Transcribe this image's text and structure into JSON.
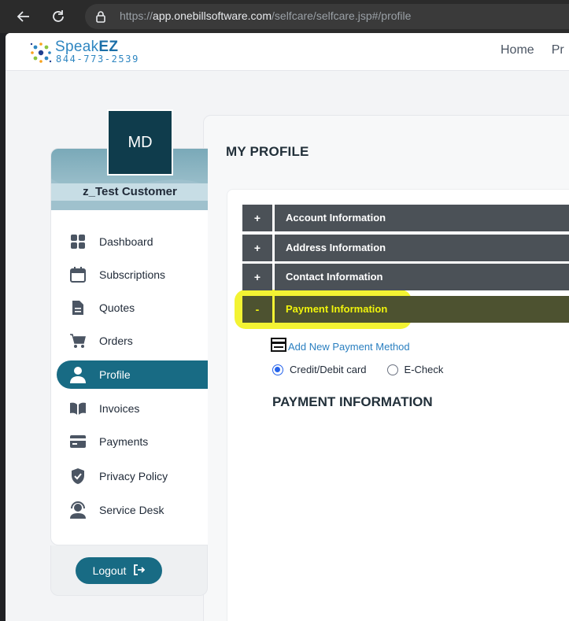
{
  "browser": {
    "url_scheme": "https://",
    "url_host": "app.onebillsoftware.com",
    "url_path": "/selfcare/selfcare.jsp#/profile",
    "icons": [
      "back-arrow-icon",
      "reload-icon",
      "site-info-icon"
    ]
  },
  "header": {
    "logo_name_light": "Speak",
    "logo_name_bold": "EZ",
    "logo_phone": "844-773-2539",
    "nav": [
      "Home",
      "Pr"
    ]
  },
  "customer": {
    "initials": "MD",
    "name": "z_Test Customer"
  },
  "sidebar": {
    "items": [
      {
        "label": "Dashboard",
        "icon": "dashboard-icon"
      },
      {
        "label": "Subscriptions",
        "icon": "calendar-icon"
      },
      {
        "label": "Quotes",
        "icon": "document-icon"
      },
      {
        "label": "Orders",
        "icon": "cart-icon"
      },
      {
        "label": "Profile",
        "icon": "user-icon",
        "active": true
      },
      {
        "label": "Invoices",
        "icon": "book-icon"
      },
      {
        "label": "Payments",
        "icon": "card-icon"
      },
      {
        "label": "Privacy Policy",
        "icon": "shield-icon"
      },
      {
        "label": "Service Desk",
        "icon": "support-icon"
      }
    ],
    "logout_label": "Logout"
  },
  "main": {
    "title": "MY PROFILE",
    "accordion": [
      {
        "toggle": "+",
        "label": "Account Information"
      },
      {
        "toggle": "+",
        "label": "Address Information"
      },
      {
        "toggle": "+",
        "label": "Contact Information"
      },
      {
        "toggle": "-",
        "label": "Payment Information",
        "open": true
      }
    ],
    "add_payment_label": "Add New Payment Method",
    "payment_types": [
      {
        "label": "Credit/Debit card",
        "checked": true
      },
      {
        "label": "E-Check",
        "checked": false
      }
    ],
    "section_title": "PAYMENT INFORMATION"
  },
  "colors": {
    "accent": "#186b84",
    "avatar": "#0f3c4c",
    "accordion": "#4b5157",
    "highlight": "#f2f21d",
    "link": "#2a7fc0"
  }
}
